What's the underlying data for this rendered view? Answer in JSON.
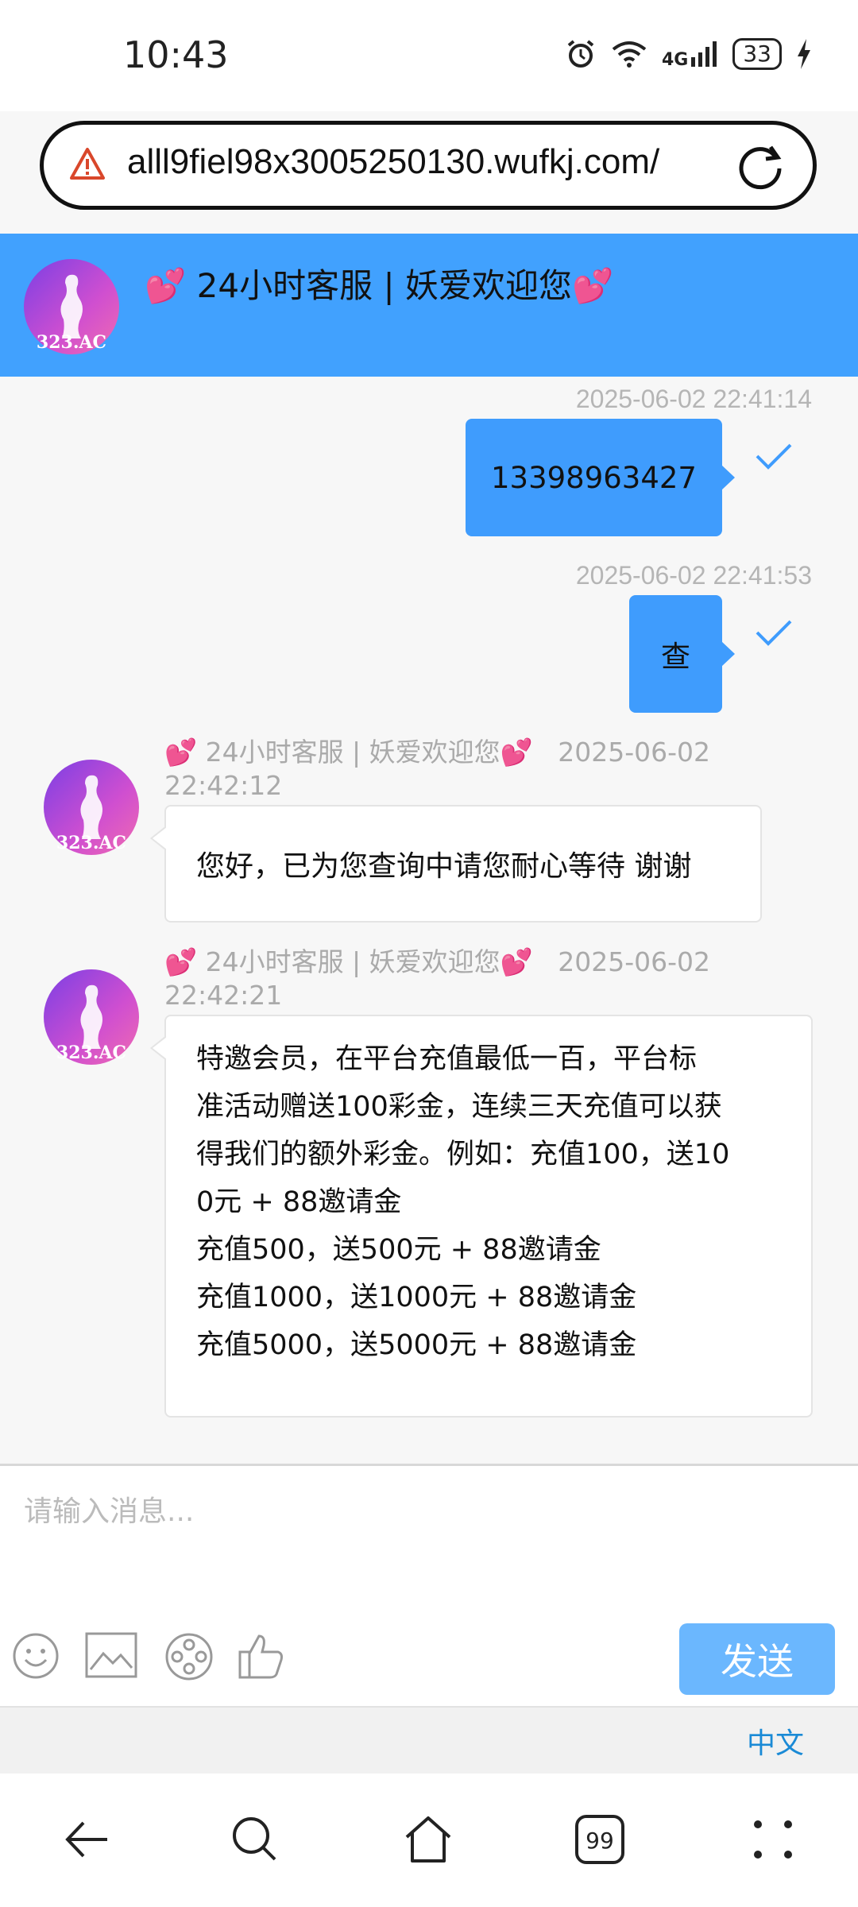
{
  "status_bar": {
    "time": "10:43",
    "network": "4G",
    "battery": "33"
  },
  "browser": {
    "url": "alll9fiel98x3005250130.wufkj.com/"
  },
  "chat": {
    "header_title": "💕 24小时客服 | 妖爱欢迎您💕",
    "avatar_text": "323.AC",
    "messages": [
      {
        "timestamp": "2025-06-02 22:41:14",
        "text": "13398963427"
      },
      {
        "timestamp": "2025-06-02 22:41:53",
        "text": "查"
      },
      {
        "agent": "💕 24小时客服 | 妖爱欢迎您💕",
        "timestamp": "2025-06-02 22:42:12",
        "text": "您好，已为您查询中请您耐心等待 谢谢"
      },
      {
        "agent": "💕 24小时客服 | 妖爱欢迎您💕",
        "timestamp": "2025-06-02 22:42:21",
        "lines": [
          "特邀会员，在平台充值最低一百，平台标",
          "准活动赠送100彩金，连续三天充值可以获",
          "得我们的额外彩金。例如：充值100，送10",
          "0元 + 88邀请金",
          "充值500，送500元 + 88邀请金",
          "充值1000，送1000元 + 88邀请金",
          "充值5000，送5000元 + 88邀请金"
        ]
      }
    ]
  },
  "input": {
    "placeholder": "请输入消息...",
    "send_label": "发送",
    "language": "中文"
  },
  "colors": {
    "header": "#41a1fe",
    "outgoing": "#3f9cfd",
    "send": "#6bb7fe",
    "lang_link": "#1a8ad6"
  },
  "icons": [
    "alarm-icon",
    "wifi-icon",
    "signal-icon",
    "battery-icon",
    "charging-icon",
    "warning-icon",
    "reload-icon",
    "check-icon",
    "emoji-icon",
    "image-icon",
    "film-icon",
    "thumbs-up-icon",
    "back-icon",
    "search-icon",
    "home-icon",
    "tabs-icon",
    "menu-icon"
  ]
}
